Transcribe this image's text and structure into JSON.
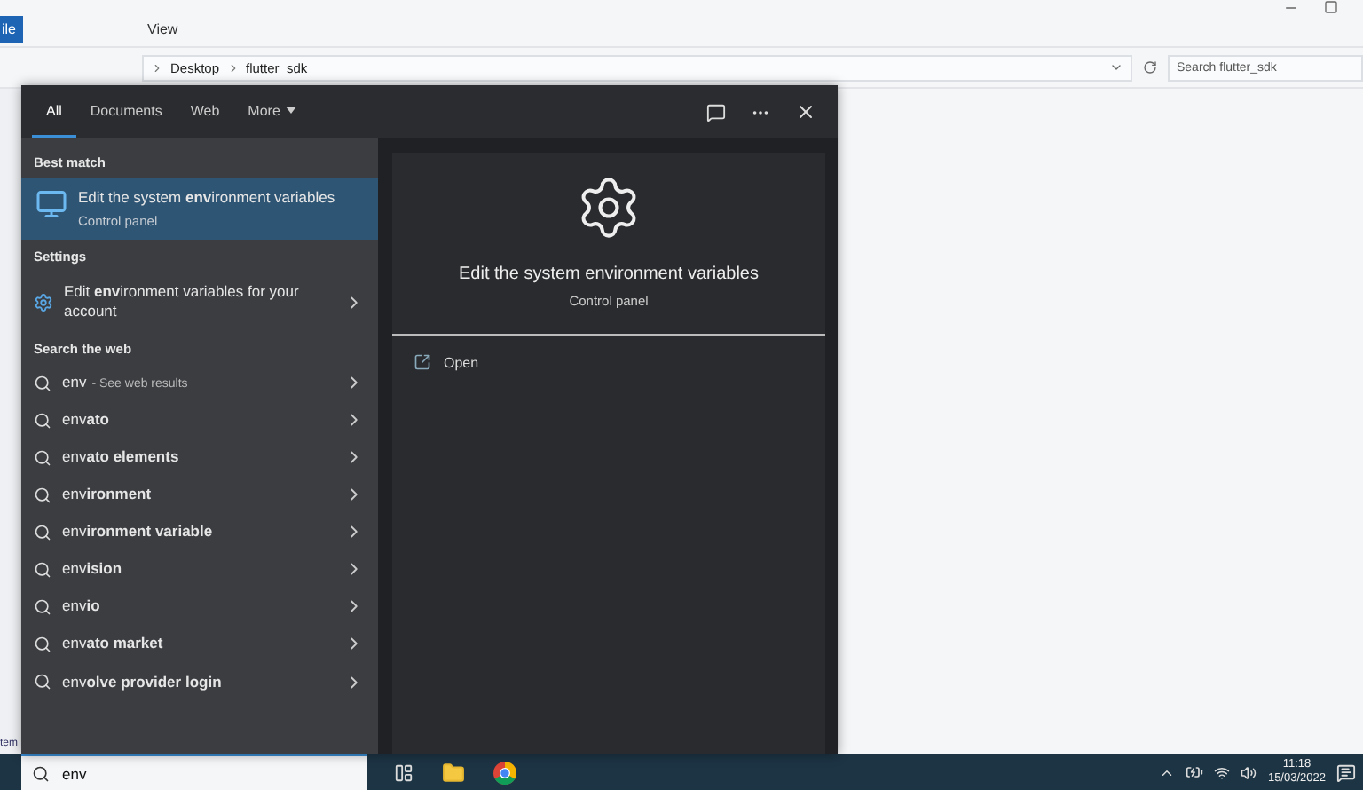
{
  "explorer": {
    "ribbon_tab": "ile",
    "menu": "View",
    "path": [
      "Desktop",
      "flutter_sdk"
    ],
    "search": {
      "placeholder": "Search flutter_sdk"
    },
    "status_text": "tem"
  },
  "search_panel": {
    "tabs": [
      {
        "label": "All",
        "kind": "tab",
        "selected": true
      },
      {
        "label": "Documents",
        "kind": "tab",
        "selected": false
      },
      {
        "label": "Web",
        "kind": "tab",
        "selected": false
      },
      {
        "label": "More",
        "kind": "menu",
        "selected": false
      }
    ],
    "sections": [
      {
        "heading": "Best match",
        "items": [
          {
            "kind": "app",
            "title": "Edit the system **env**ironment variables",
            "subtitle": "Control panel",
            "selected": true
          }
        ]
      },
      {
        "heading": "Settings",
        "items": [
          {
            "kind": "setting",
            "title": "Edit **env**ironment variables for your account",
            "selected": false
          }
        ]
      },
      {
        "heading": "Search the web",
        "items": [
          {
            "kind": "web",
            "title": "env",
            "hint": "- See web results",
            "selected": false
          },
          {
            "kind": "web",
            "title": "env**ato**",
            "selected": false
          },
          {
            "kind": "web",
            "title": "env**ato elements**",
            "selected": false
          },
          {
            "kind": "web",
            "title": "env**ironment**",
            "selected": false
          },
          {
            "kind": "web",
            "title": "env**ironment variable**",
            "selected": false
          },
          {
            "kind": "web",
            "title": "env**ision**",
            "selected": false
          },
          {
            "kind": "web",
            "title": "env**io**",
            "selected": false
          },
          {
            "kind": "web",
            "title": "env**ato market**",
            "selected": false
          },
          {
            "kind": "web",
            "title": "env**olve provider login**",
            "selected": false
          }
        ]
      }
    ],
    "preview": {
      "title": "Edit the system environment variables",
      "subtitle": "Control panel",
      "actions": [
        "Open"
      ]
    }
  },
  "search_box": {
    "value": "env"
  },
  "taskbar": {
    "time": "11:18",
    "date": "15/03/2022"
  }
}
